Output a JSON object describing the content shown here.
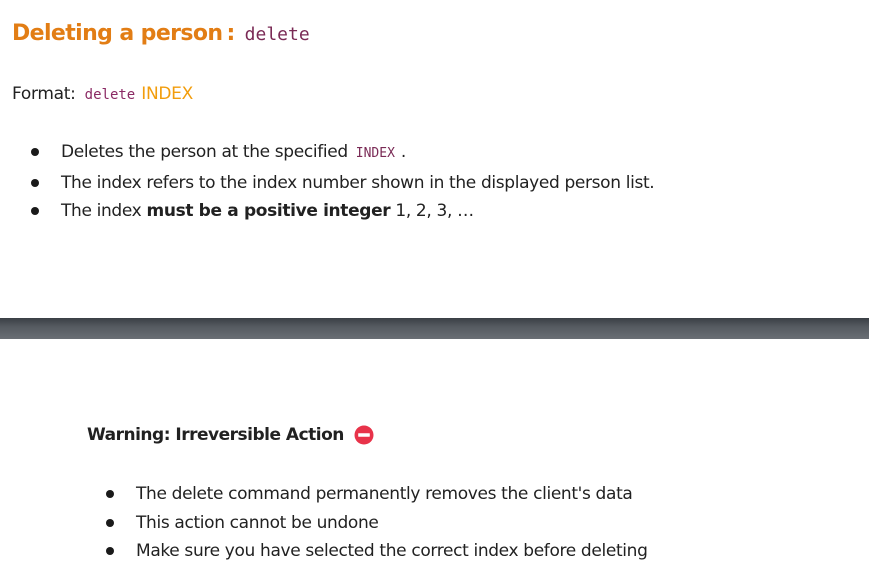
{
  "heading": {
    "text": "Deleting a person",
    "separator": ":",
    "command": "delete"
  },
  "format": {
    "label": "Format:",
    "command": "delete",
    "parameter": "INDEX"
  },
  "description": {
    "item1": {
      "before": "Deletes the person at the specified",
      "code": "INDEX",
      "after": "."
    },
    "item2": "The index refers to the index number shown in the displayed person list.",
    "item3": {
      "before": "The index",
      "bold": "must be a positive integer",
      "after": "1, 2, 3, …"
    }
  },
  "warning": {
    "title": "Warning: Irreversible Action",
    "icon": "no-entry-icon",
    "icon_color": "#e8334a",
    "items": [
      "The delete command permanently removes the client's data",
      "This action cannot be undone",
      "Make sure you have selected the correct index before deleting"
    ]
  },
  "colors": {
    "heading": "#e27d14",
    "code": "#7a2a55",
    "parameter": "#f29d0c",
    "divider": "#4a4f55"
  }
}
